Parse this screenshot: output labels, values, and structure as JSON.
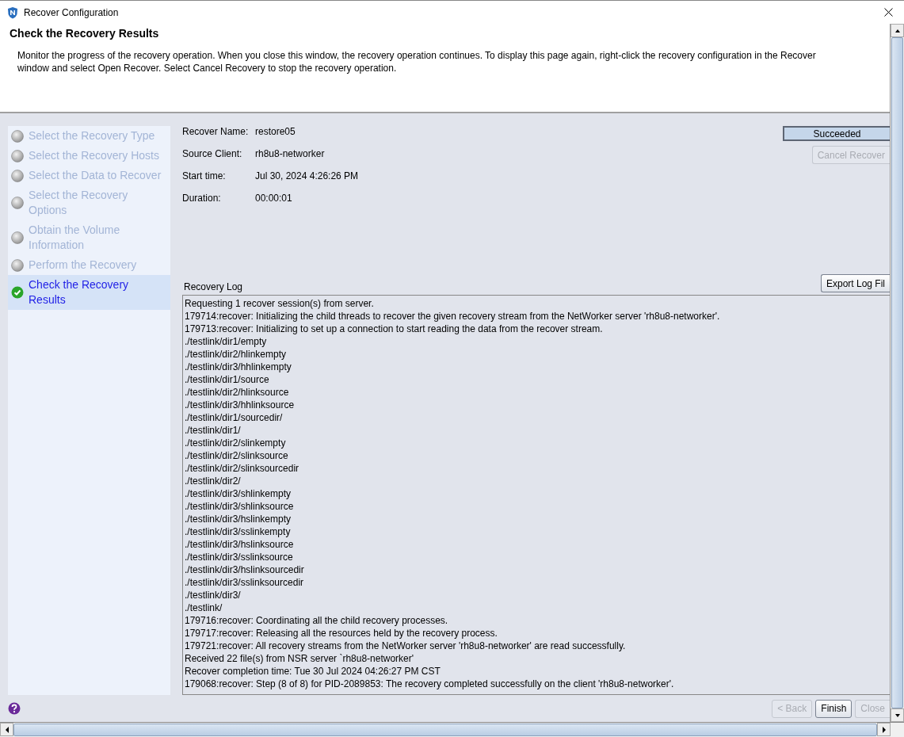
{
  "window": {
    "title": "Recover Configuration"
  },
  "header": {
    "title": "Check the Recovery Results",
    "description": "Monitor the progress of the recovery operation. When you close this window, the recovery operation continues. To display this page again, right-click the recovery configuration in the Recover window and select Open Recover. Select Cancel Recovery to stop the recovery operation."
  },
  "steps": [
    {
      "label": "Select the Recovery Type",
      "selected": false
    },
    {
      "label": "Select the Recovery Hosts",
      "selected": false
    },
    {
      "label": "Select the Data to Recover",
      "selected": false
    },
    {
      "label": "Select the Recovery Options",
      "selected": false
    },
    {
      "label": "Obtain the Volume Information",
      "selected": false
    },
    {
      "label": "Perform the Recovery",
      "selected": false
    },
    {
      "label": "Check the Recovery Results",
      "selected": true
    }
  ],
  "details": [
    {
      "label": "Recover Name:",
      "value": "restore05"
    },
    {
      "label": "Source Client:",
      "value": "rh8u8-networker"
    },
    {
      "label": "Start time:",
      "value": "Jul 30, 2024 4:26:26 PM"
    },
    {
      "label": "Duration:",
      "value": "00:00:01"
    }
  ],
  "status": "Succeeded",
  "cancel_button": {
    "label": "Cancel Recover",
    "disabled": true
  },
  "log": {
    "title": "Recovery Log",
    "export_button": "Export Log Fil",
    "lines": [
      "Requesting 1 recover session(s) from server.",
      "179714:recover: Initializing the child threads to recover the given recovery stream from the NetWorker server 'rh8u8-networker'.",
      "179713:recover: Initializing to set up a connection to start reading the data from the recover stream.",
      "./testlink/dir1/empty",
      "./testlink/dir2/hlinkempty",
      "./testlink/dir3/hhlinkempty",
      "./testlink/dir1/source",
      "./testlink/dir2/hlinksource",
      "./testlink/dir3/hhlinksource",
      "./testlink/dir1/sourcedir/",
      "./testlink/dir1/",
      "./testlink/dir2/slinkempty",
      "./testlink/dir2/slinksource",
      "./testlink/dir2/slinksourcedir",
      "./testlink/dir2/",
      "./testlink/dir3/shlinkempty",
      "./testlink/dir3/shlinksource",
      "./testlink/dir3/hslinkempty",
      "./testlink/dir3/sslinkempty",
      "./testlink/dir3/hslinksource",
      "./testlink/dir3/sslinksource",
      "./testlink/dir3/hslinksourcedir",
      "./testlink/dir3/sslinksourcedir",
      "./testlink/dir3/",
      "./testlink/",
      "179716:recover: Coordinating all the child recovery processes.",
      "179717:recover: Releasing all the resources held by the recovery process.",
      "179721:recover: All recovery streams from the NetWorker server 'rh8u8-networker' are read successfully.",
      "Received 22 file(s) from NSR server `rh8u8-networker'",
      "Recover completion time: Tue 30 Jul 2024 04:26:27 PM CST",
      "179068:recover: Step (8 of 8) for PID-2089853: The recovery completed successfully on the client 'rh8u8-networker'."
    ]
  },
  "footer_buttons": [
    {
      "label": "< Back",
      "disabled": true
    },
    {
      "label": "Finish",
      "disabled": false
    },
    {
      "label": "Close",
      "disabled": true
    }
  ]
}
